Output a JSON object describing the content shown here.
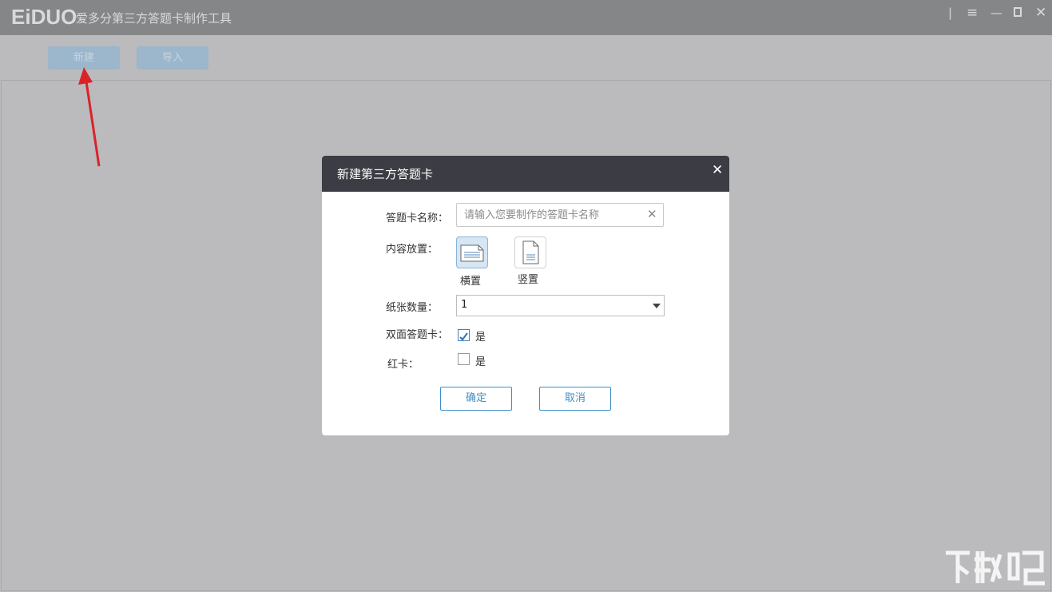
{
  "app": {
    "logo_text": "EiDUO",
    "title": "爱多分第三方答题卡制作工具"
  },
  "toolbar": {
    "new_label": "新建",
    "import_label": "导入"
  },
  "dialog": {
    "title": "新建第三方答题卡",
    "name_label": "答题卡名称：",
    "name_placeholder": "请输入您要制作的答题卡名称",
    "name_value": "",
    "layout_label": "内容放置：",
    "layout_options": [
      {
        "label": "横置",
        "selected": true
      },
      {
        "label": "竖置",
        "selected": false
      }
    ],
    "paper_count_label": "纸张数量：",
    "paper_count_value": "1",
    "double_sided_label": "双面答题卡：",
    "double_sided_option": "是",
    "double_sided_checked": true,
    "red_card_label": "红卡：",
    "red_card_option": "是",
    "red_card_checked": false,
    "confirm_label": "确定",
    "cancel_label": "取消"
  },
  "colors": {
    "titlebar": "#858688",
    "background": "#bbbabc",
    "dialog_header": "#3c3c44",
    "accent": "#3f8fc8",
    "arrow": "#d9232a"
  }
}
